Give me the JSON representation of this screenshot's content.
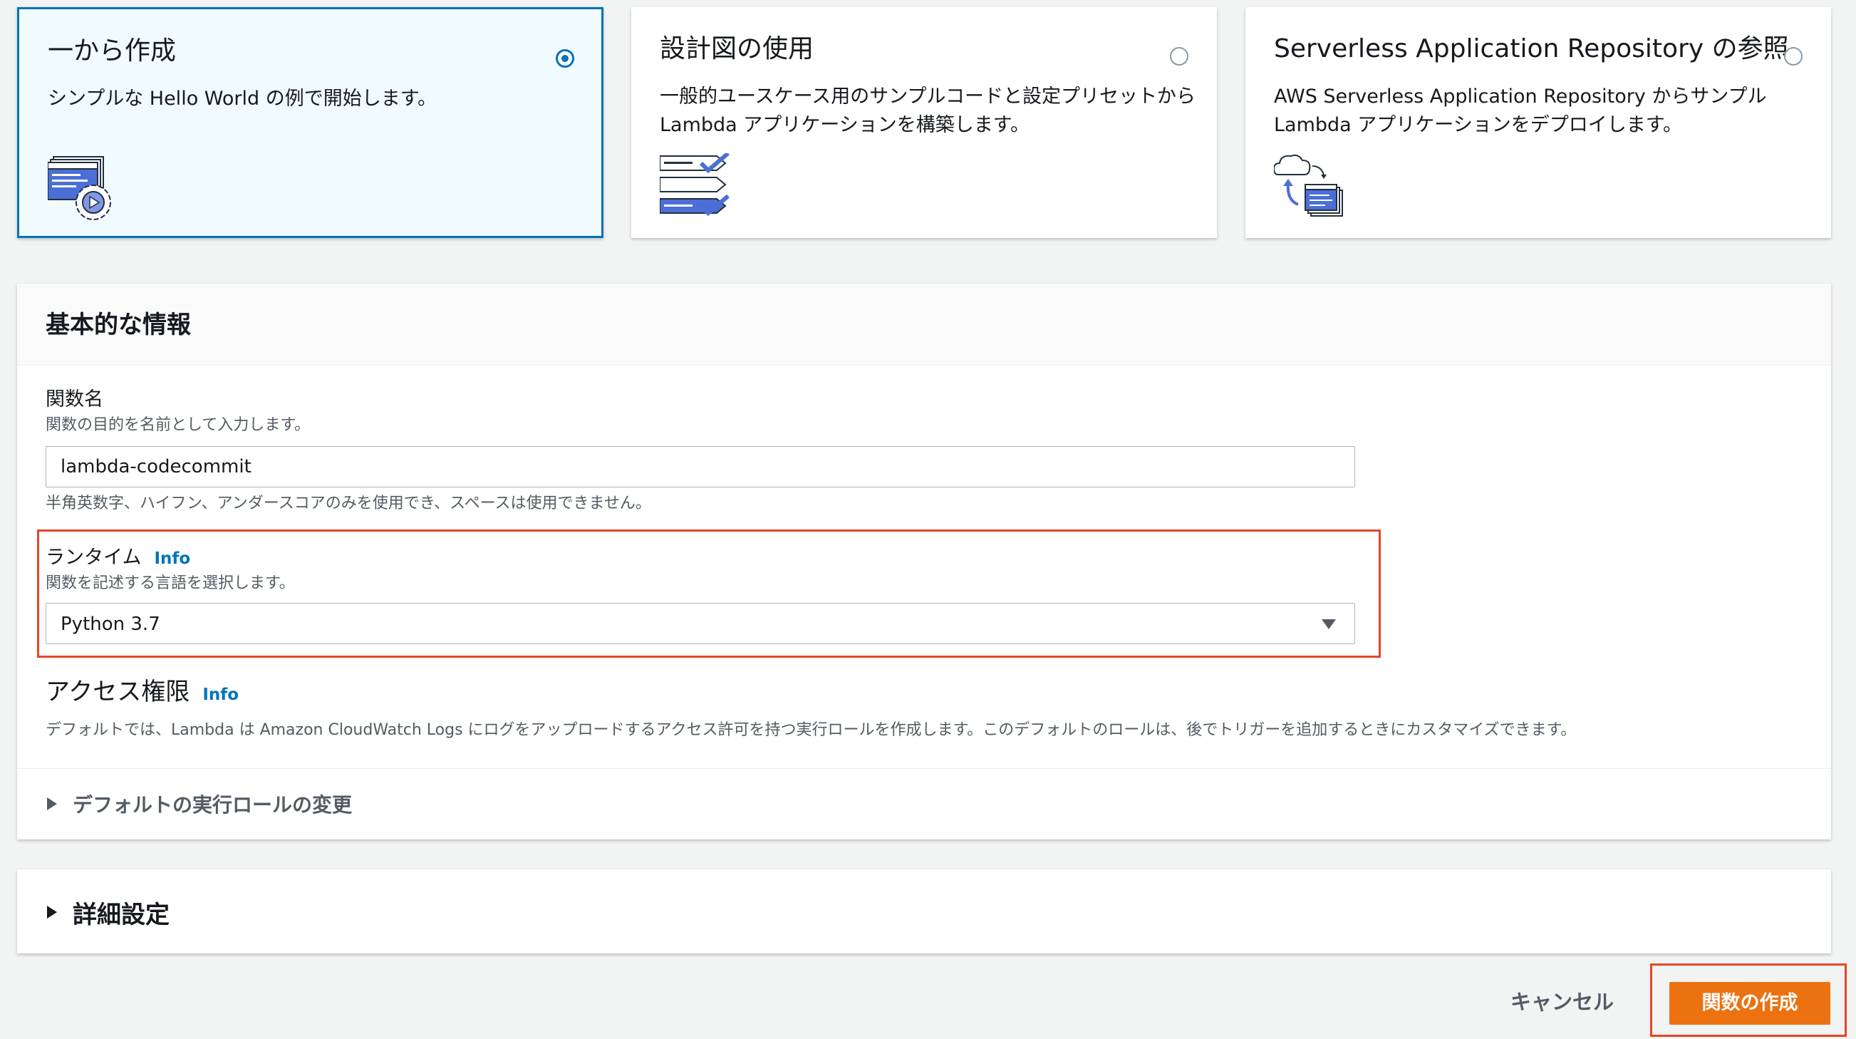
{
  "options": [
    {
      "title": "一から作成",
      "description": "シンプルな Hello World の例で開始します。",
      "selected": true,
      "icon": "code-window-gear-icon"
    },
    {
      "title": "設計図の使用",
      "description": "一般的ユースケース用のサンプルコードと設定プリセットから Lambda アプリケーションを構築します。",
      "selected": false,
      "icon": "blueprint-checklist-icon"
    },
    {
      "title": "Serverless Application Repository の参照",
      "description": "AWS Serverless Application Repository からサンプル Lambda アプリケーションをデプロイします。",
      "selected": false,
      "icon": "cloud-deploy-icon"
    }
  ],
  "basic_info": {
    "title": "基本的な情報",
    "function_name": {
      "label": "関数名",
      "description": "関数の目的を名前として入力します。",
      "value": "lambda-codecommit",
      "hint": "半角英数字、ハイフン、アンダースコアのみを使用でき、スペースは使用できません。"
    },
    "runtime": {
      "label": "ランタイム",
      "info": "Info",
      "description": "関数を記述する言語を選択します。",
      "value": "Python 3.7"
    },
    "permissions": {
      "label": "アクセス権限",
      "info": "Info",
      "description": "デフォルトでは、Lambda は Amazon CloudWatch Logs にログをアップロードするアクセス許可を持つ実行ロールを作成します。このデフォルトのロールは、後でトリガーを追加するときにカスタマイズできます。",
      "expander": "デフォルトの実行ロールの変更"
    }
  },
  "advanced": {
    "title": "詳細設定"
  },
  "footer": {
    "cancel_label": "キャンセル",
    "create_label": "関数の作成"
  },
  "colors": {
    "accent": "#0073bb",
    "primary_button": "#ec7211",
    "highlight": "#e8442a"
  }
}
